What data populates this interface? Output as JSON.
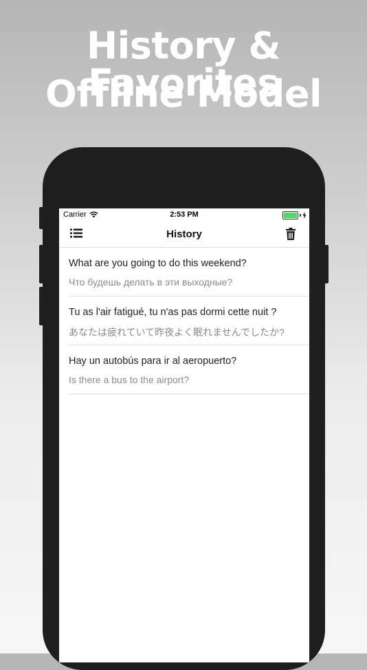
{
  "promo": {
    "line1": "History & Favorites",
    "line2": "Offline Model"
  },
  "status_bar": {
    "carrier": "Carrier",
    "time": "2:53 PM",
    "wifi_icon": "wifi-icon",
    "battery_icon": "battery-charging-icon"
  },
  "nav": {
    "title": "History",
    "left_icon": "list-menu-icon",
    "right_icon": "trash-icon"
  },
  "history": [
    {
      "source": "What are you going to do this weekend?",
      "translation": "Что будешь делать в эти выходные?"
    },
    {
      "source": "Tu as l'air fatigué, tu n'as pas dormi cette nuit ?",
      "translation": "あなたは疲れていて昨夜よく眠れませんでしたか?"
    },
    {
      "source": "Hay un autobús para ir al aeropuerto?",
      "translation": "Is there a bus to the airport?"
    }
  ],
  "colors": {
    "battery": "#4cd964",
    "phone_frame": "#1e1e1e",
    "headline": "#ffffff"
  }
}
